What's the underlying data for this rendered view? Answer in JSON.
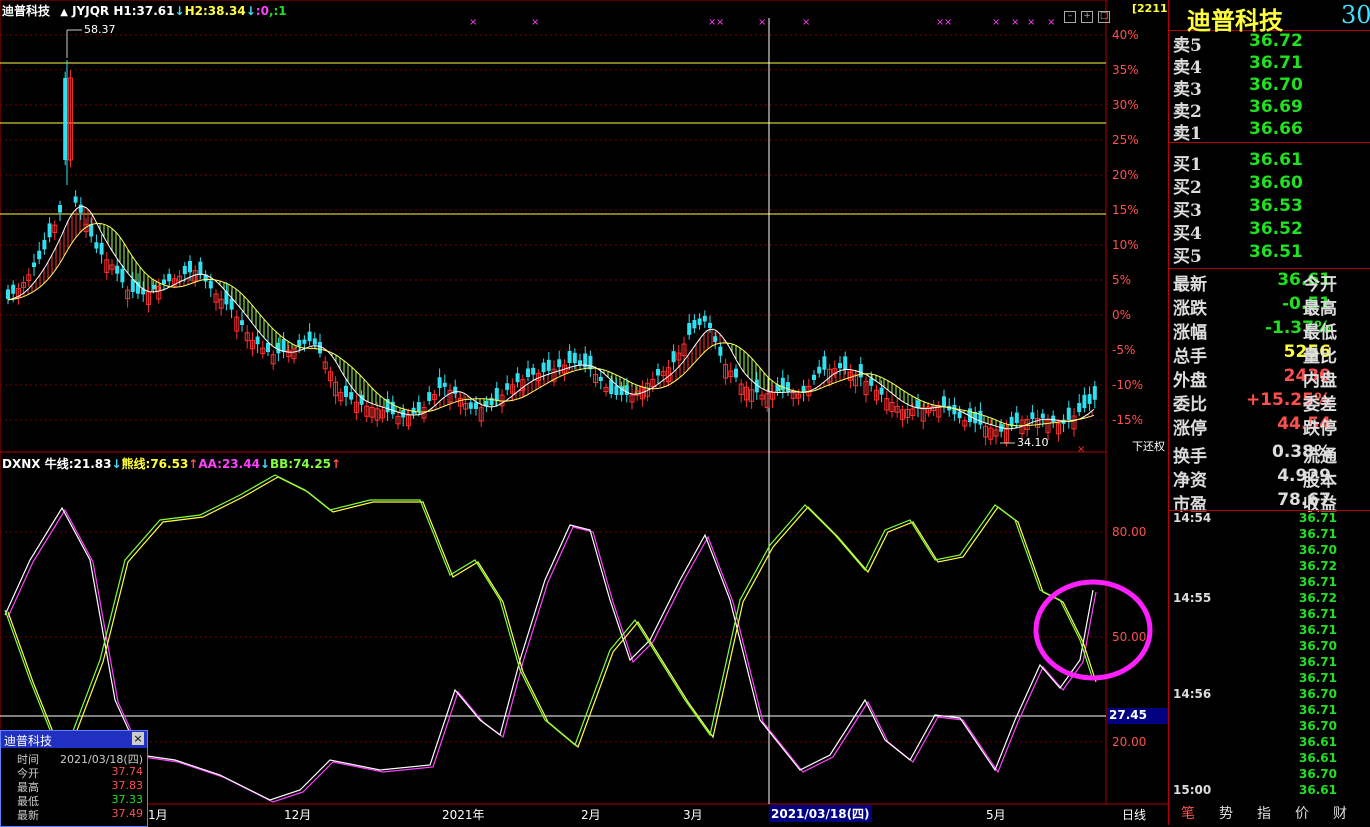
{
  "header": {
    "stock_name": "迪普科技",
    "indicator": "JYJQR",
    "h1": "H1:37.61",
    "h1_arrow": "↓",
    "h2": "H2:38.34",
    "h2_arrow": "↓",
    "z": ":0",
    "w": ",:1",
    "code_badge": "[2211]"
  },
  "price_axis": [
    "40%",
    "35%",
    "30%",
    "25%",
    "20%",
    "15%",
    "10%",
    "5%",
    "0%",
    "-5%",
    "-10%",
    "-15%"
  ],
  "price_labels": {
    "high": "58.37",
    "low": "34.10",
    "restore": "下还权"
  },
  "indicator_header": {
    "name": "DXNX",
    "niu": "牛线:21.83",
    "niu_arrow": "↓",
    "xiong": "熊线:76.53",
    "xiong_arrow": "↑",
    "aa": "AA:23.44",
    "aa_arrow": "↓",
    "bb": "BB:74.25",
    "bb_arrow": "↑"
  },
  "indicator_axis": [
    "80.00",
    "50.00",
    "20.00"
  ],
  "cursor_value": "27.45",
  "date_axis": [
    "1月",
    "12月",
    "2021年",
    "2月",
    "3月",
    "2021/03/18(四)",
    "5月"
  ],
  "bottom_tab": "日线",
  "quote": {
    "title": "迪普科技",
    "title_num": "30",
    "asks": [
      {
        "label": "卖5",
        "price": "36.72"
      },
      {
        "label": "卖4",
        "price": "36.71"
      },
      {
        "label": "卖3",
        "price": "36.70"
      },
      {
        "label": "卖2",
        "price": "36.69"
      },
      {
        "label": "卖1",
        "price": "36.66"
      }
    ],
    "bids": [
      {
        "label": "买1",
        "price": "36.61"
      },
      {
        "label": "买2",
        "price": "36.60"
      },
      {
        "label": "买3",
        "price": "36.53"
      },
      {
        "label": "买4",
        "price": "36.52"
      },
      {
        "label": "买5",
        "price": "36.51"
      }
    ],
    "stats": [
      {
        "label": "最新",
        "value": "36.61",
        "label2": "今开",
        "color": "#20e020"
      },
      {
        "label": "涨跌",
        "value": "-0.51",
        "label2": "最高",
        "color": "#20e020"
      },
      {
        "label": "涨幅",
        "value": "-1.37%",
        "label2": "最低",
        "color": "#20e020"
      },
      {
        "label": "总手",
        "value": "5256",
        "label2": "量比",
        "color": "#ffff40"
      },
      {
        "label": "外盘",
        "value": "2430",
        "label2": "内盘",
        "color": "#ff5050"
      },
      {
        "label": "委比",
        "value": "+15.25%",
        "label2": "委差",
        "color": "#ff5050"
      },
      {
        "label": "涨停",
        "value": "44.54",
        "label2": "跌停",
        "color": "#ff5050"
      },
      {
        "label": "换手",
        "value": "0.38%",
        "label2": "流通",
        "color": "#dddddd"
      },
      {
        "label": "净资",
        "value": "4.929",
        "label2": "股本",
        "color": "#dddddd"
      },
      {
        "label": "市盈",
        "value": "78.67",
        "label2": "收益",
        "color": "#dddddd"
      }
    ],
    "ticks": [
      {
        "time": "14:54",
        "price": "36.71"
      },
      {
        "time": "",
        "price": "36.71"
      },
      {
        "time": "",
        "price": "36.70"
      },
      {
        "time": "",
        "price": "36.72"
      },
      {
        "time": "",
        "price": "36.71"
      },
      {
        "time": "14:55",
        "price": "36.72"
      },
      {
        "time": "",
        "price": "36.71"
      },
      {
        "time": "",
        "price": "36.71"
      },
      {
        "time": "",
        "price": "36.70"
      },
      {
        "time": "",
        "price": "36.71"
      },
      {
        "time": "",
        "price": "36.71"
      },
      {
        "time": "14:56",
        "price": "36.70"
      },
      {
        "time": "",
        "price": "36.71"
      },
      {
        "time": "",
        "price": "36.70"
      },
      {
        "time": "",
        "price": "36.61"
      },
      {
        "time": "",
        "price": "36.61"
      },
      {
        "time": "",
        "price": "36.70"
      },
      {
        "time": "15:00",
        "price": "36.61"
      }
    ],
    "tabs": [
      "笔",
      "势",
      "指",
      "价",
      "财"
    ]
  },
  "popup": {
    "title": "迪普科技",
    "close": "×",
    "rows": [
      {
        "label": "时间",
        "value": "2021/03/18(四)",
        "color": "#cccccc"
      },
      {
        "label": "今开",
        "value": "37.74",
        "color": "#ff5050"
      },
      {
        "label": "最高",
        "value": "37.83",
        "color": "#ff5050"
      },
      {
        "label": "最低",
        "value": "37.33",
        "color": "#20e020"
      },
      {
        "label": "最新",
        "value": "37.49",
        "color": "#ff5050"
      }
    ]
  },
  "colors": {
    "up": "#ff3030",
    "down": "#30e0f0",
    "ma_fill": "#a0ff40",
    "ma_line": "#ffff60",
    "niu_line": "#ffffff",
    "xiong_line": "#80ff40",
    "aa_line": "#ff40ff",
    "bb_line": "#ffff40",
    "highlight_circle": "#ff20ff"
  }
}
